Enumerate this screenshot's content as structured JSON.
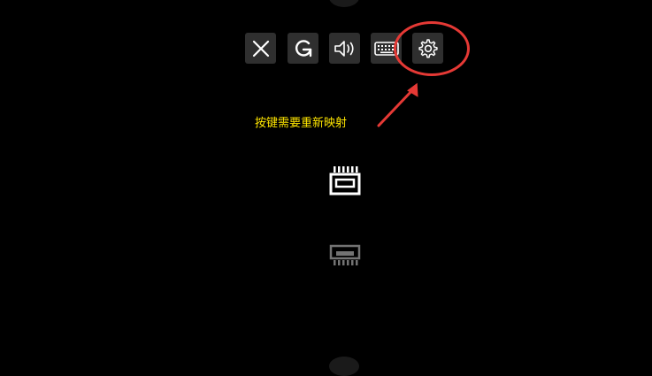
{
  "annotation": {
    "hint_text": "按键需要重新映射",
    "highlight_color": "#e53935",
    "text_color": "#ffe600"
  },
  "toolbar": {
    "buttons": [
      {
        "icon": "close-icon"
      },
      {
        "icon": "refresh-icon"
      },
      {
        "icon": "volume-icon"
      },
      {
        "icon": "keyboard-icon"
      },
      {
        "icon": "gear-icon"
      }
    ]
  },
  "slots": [
    {
      "icon": "save-slot-icon",
      "state": "active"
    },
    {
      "icon": "save-slot-icon",
      "state": "inactive"
    }
  ]
}
